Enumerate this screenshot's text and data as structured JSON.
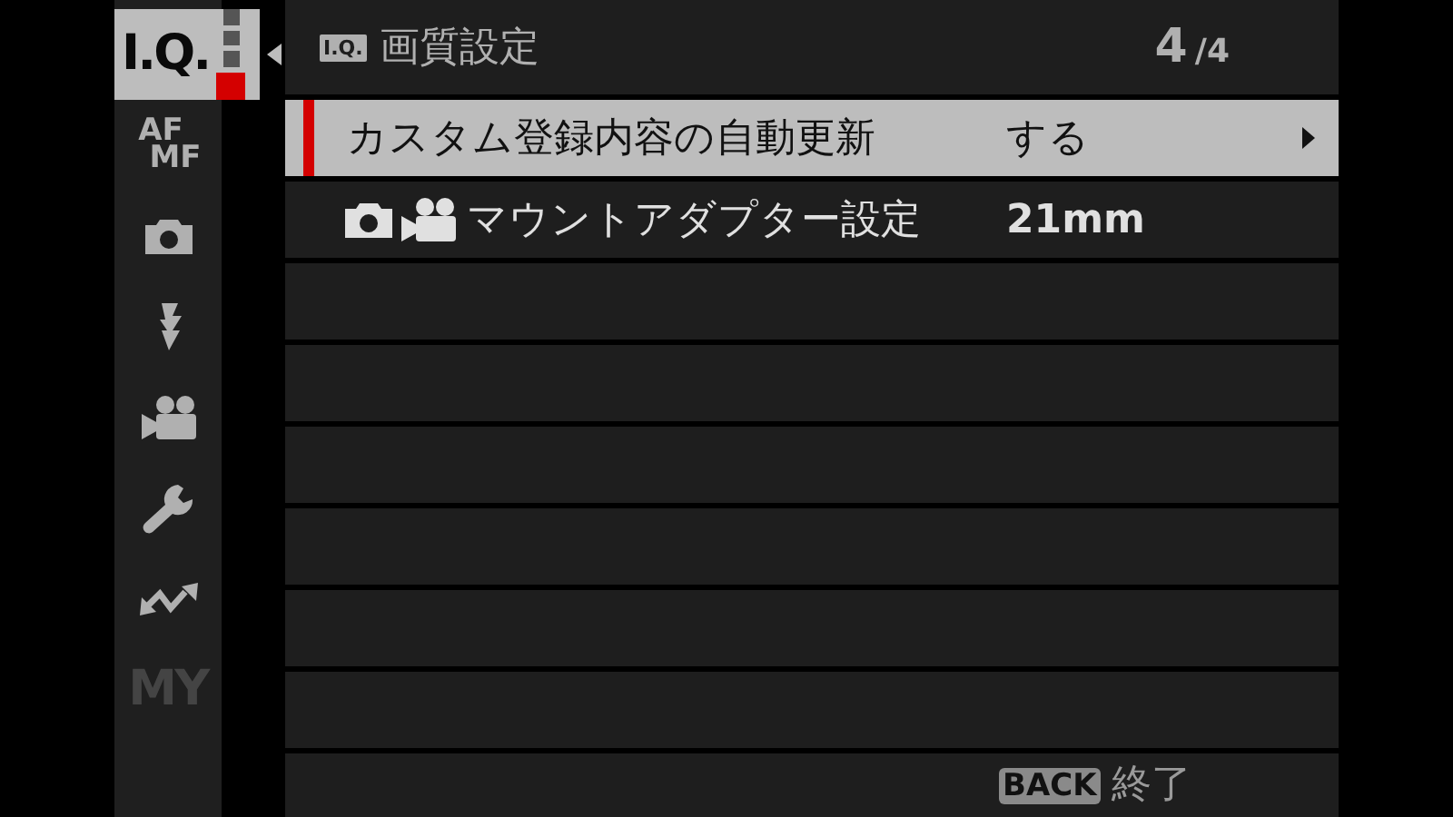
{
  "sidebar": {
    "tabs": [
      {
        "kind": "iq",
        "label": "I.Q.",
        "selected": true,
        "disabled": false
      },
      {
        "kind": "afmf",
        "lines": [
          "AF",
          "MF"
        ],
        "selected": false,
        "disabled": false
      },
      {
        "kind": "camera",
        "selected": false,
        "disabled": false
      },
      {
        "kind": "flash",
        "selected": false,
        "disabled": false
      },
      {
        "kind": "movie",
        "selected": false,
        "disabled": false
      },
      {
        "kind": "wrench",
        "selected": false,
        "disabled": false
      },
      {
        "kind": "wireless",
        "selected": false,
        "disabled": false
      },
      {
        "kind": "my",
        "label": "MY",
        "selected": false,
        "disabled": true
      }
    ],
    "pages": [
      {
        "selected": false
      },
      {
        "selected": false
      },
      {
        "selected": false
      },
      {
        "selected": true
      }
    ]
  },
  "header": {
    "badge": "I.Q.",
    "title": "画質設定",
    "page": "4",
    "total": "/4"
  },
  "rows": [
    {
      "label": "カスタム登録内容の自動更新",
      "value": "する",
      "selected": true,
      "submenu": true,
      "mode_icons": false
    },
    {
      "label": "マウントアダプター設定",
      "value": "21mm",
      "selected": false,
      "submenu": false,
      "mode_icons": true
    }
  ],
  "footer": {
    "key": "BACK",
    "label": "終了"
  }
}
